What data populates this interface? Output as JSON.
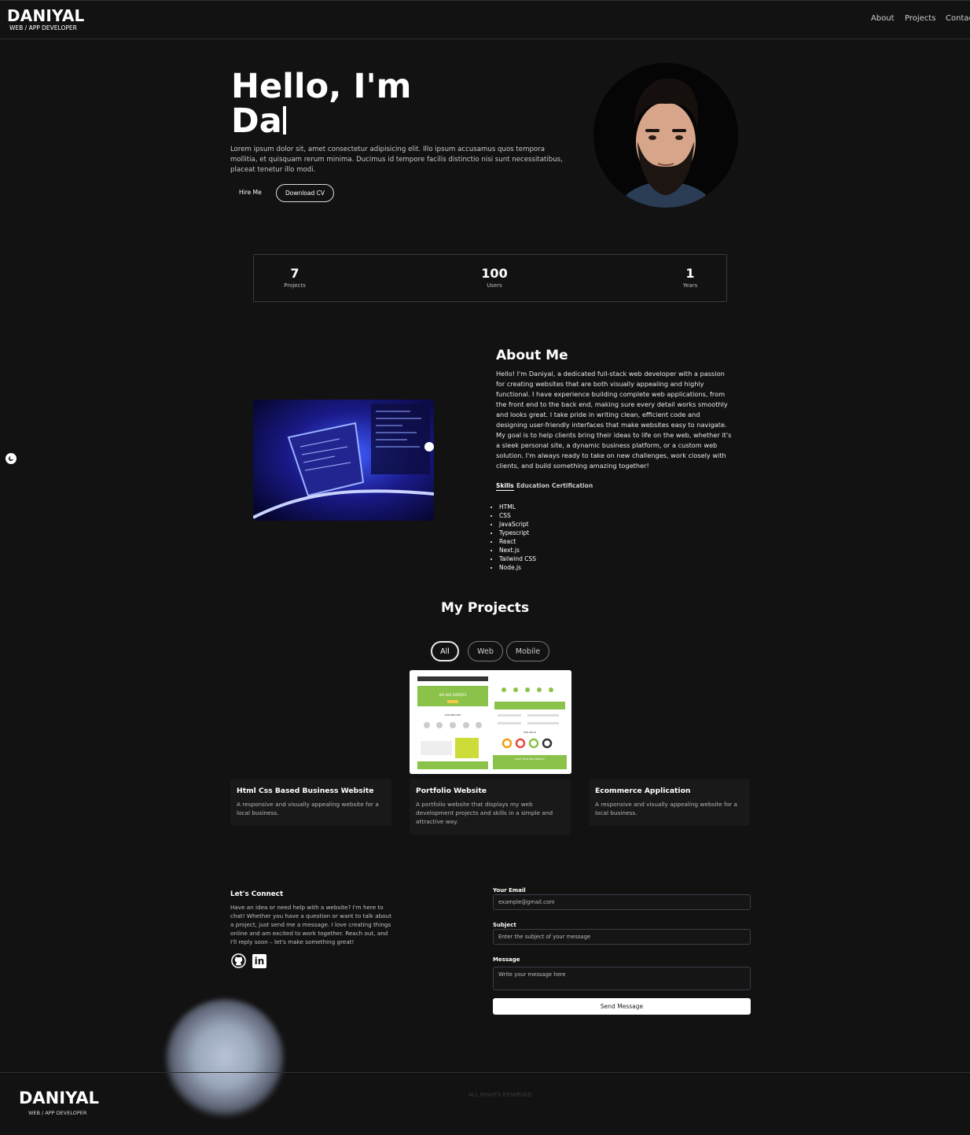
{
  "brand": {
    "name": "DANIYAL",
    "tagline": "WEB / APP DEVELOPER"
  },
  "nav": {
    "items": [
      "About",
      "Projects",
      "Contac"
    ]
  },
  "hero": {
    "title_line1": "Hello, I'm",
    "title_line2": "Da",
    "description": "Lorem ipsum dolor sit, amet consectetur adipisicing elit. Illo ipsum accusamus quos tempora mollitia, et quisquam rerum minima. Ducimus id tempore facilis distinctio nisi sunt necessitatibus, placeat tenetur illo modi.",
    "hire_label": "Hire Me",
    "cv_label": "Download CV"
  },
  "stats": [
    {
      "value": "7",
      "label": "Projects"
    },
    {
      "value": "100",
      "label": "Users"
    },
    {
      "value": "1",
      "label": "Years"
    }
  ],
  "about": {
    "title": "About Me",
    "text": "Hello! I'm Daniyal, a dedicated full-stack web developer with a passion for creating websites that are both visually appealing and highly functional. I have experience building complete web applications, from the front end to the back end, making sure every detail works smoothly and looks great. I take pride in writing clean, efficient code and designing user-friendly interfaces that make websites easy to navigate. My goal is to help clients bring their ideas to life on the web, whether it's a sleek personal site, a dynamic business platform, or a custom web solution. I'm always ready to take on new challenges, work closely with clients, and build something amazing together!",
    "tabs": [
      "Skills",
      "Education",
      "Certification"
    ],
    "skills": [
      "HTML",
      "CSS",
      "JavaScript",
      "Typescript",
      "React",
      "Next.js",
      "Tailwind CSS",
      "Node.js"
    ]
  },
  "projects": {
    "title": "My Projects",
    "filters": [
      "All",
      "Web",
      "Mobile"
    ],
    "cards": [
      {
        "title": "Html Css Based Business Website",
        "desc": "A responsive and visually appealing website for a local business."
      },
      {
        "title": "Portfolio Website",
        "desc": "A portfolio website that displays my web development projects and skills in a simple and attractive way."
      },
      {
        "title": "Ecommerce Application",
        "desc": "A responsive and visually appealing website for a local business."
      }
    ],
    "shot": {
      "banner": "WE ARE EXPERTS",
      "services": "OUR SERVICES",
      "skills": "OUR SKILLS",
      "cta": "START YOUR NEW PROJECT"
    }
  },
  "connect": {
    "title": "Let's Connect",
    "text": "Have an idea or need help with a website? I'm here to chat! Whether you have a question or want to talk about a project, just send me a message. I love creating things online and am excited to work together. Reach out, and I'll reply soon – let's make something great!",
    "email_label": "Your Email",
    "email_placeholder": "example@gmail.com",
    "subject_label": "Subject",
    "subject_placeholder": "Enter the subject of your message",
    "message_label": "Message",
    "message_placeholder": "Write your message here",
    "send_label": "Send Message",
    "social": [
      "github-icon",
      "linkedin-icon"
    ],
    "linkedin_text": "in"
  },
  "footer": {
    "name": "DANIYAL",
    "tagline": "WEB / APP DEVELOPER",
    "rights": "ALL RIGHTS RESERVED"
  },
  "colors": {
    "background": "#121212",
    "accent_green": "#8bc34a",
    "card": "#191919"
  }
}
